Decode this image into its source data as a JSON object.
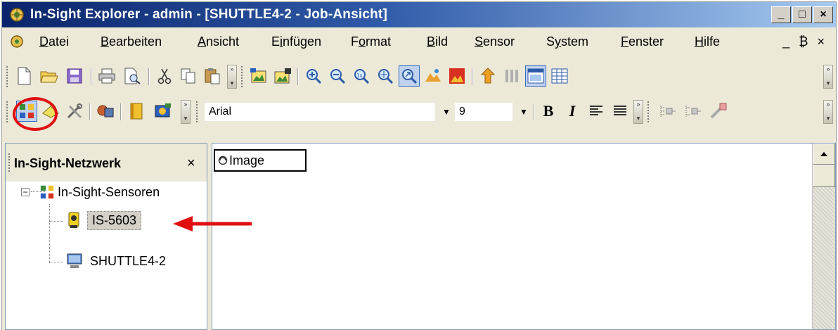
{
  "window": {
    "title": "In-Sight Explorer - admin - [SHUTTLE4-2 - Job-Ansicht]",
    "minimize_glyph": "_",
    "maximize_glyph": "□",
    "close_glyph": "×"
  },
  "menubar": {
    "items": [
      {
        "accel": "D",
        "rest": "atei"
      },
      {
        "accel": "B",
        "rest": "earbeiten"
      },
      {
        "accel": "A",
        "rest": "nsicht"
      },
      {
        "pre": "E",
        "accel": "i",
        "rest": "nfügen"
      },
      {
        "pre": "F",
        "accel": "o",
        "rest": "rmat"
      },
      {
        "accel": "B",
        "rest": "ild"
      },
      {
        "accel": "S",
        "rest": "ensor"
      },
      {
        "pre": "S",
        "accel": "y",
        "rest": "stem"
      },
      {
        "accel": "F",
        "rest": "enster"
      },
      {
        "accel": "H",
        "rest": "ilfe"
      }
    ],
    "mdi_controls": "_ ₿ ×"
  },
  "formatbar": {
    "font_name": "Arial",
    "font_size": "9",
    "bold_label": "B",
    "italic_label": "I"
  },
  "network_panel": {
    "title": "In-Sight-Netzwerk",
    "close_glyph": "×",
    "tree": {
      "root_label": "In-Sight-Sensoren",
      "root_expander": "−",
      "children": [
        {
          "label": "IS-5603",
          "icon": "camera-sensor-icon",
          "selected": true
        },
        {
          "label": "SHUTTLE4-2",
          "icon": "computer-icon",
          "selected": false
        }
      ]
    }
  },
  "spreadsheet": {
    "cell_label": "Image",
    "cell_icon": "image-cell-icon"
  },
  "annotations": {
    "circle_color": "#e01010",
    "arrow_color": "#e01010"
  },
  "colors": {
    "titlebar_start": "#0a246a",
    "titlebar_end": "#a6caf0",
    "chrome": "#ece9d8"
  }
}
